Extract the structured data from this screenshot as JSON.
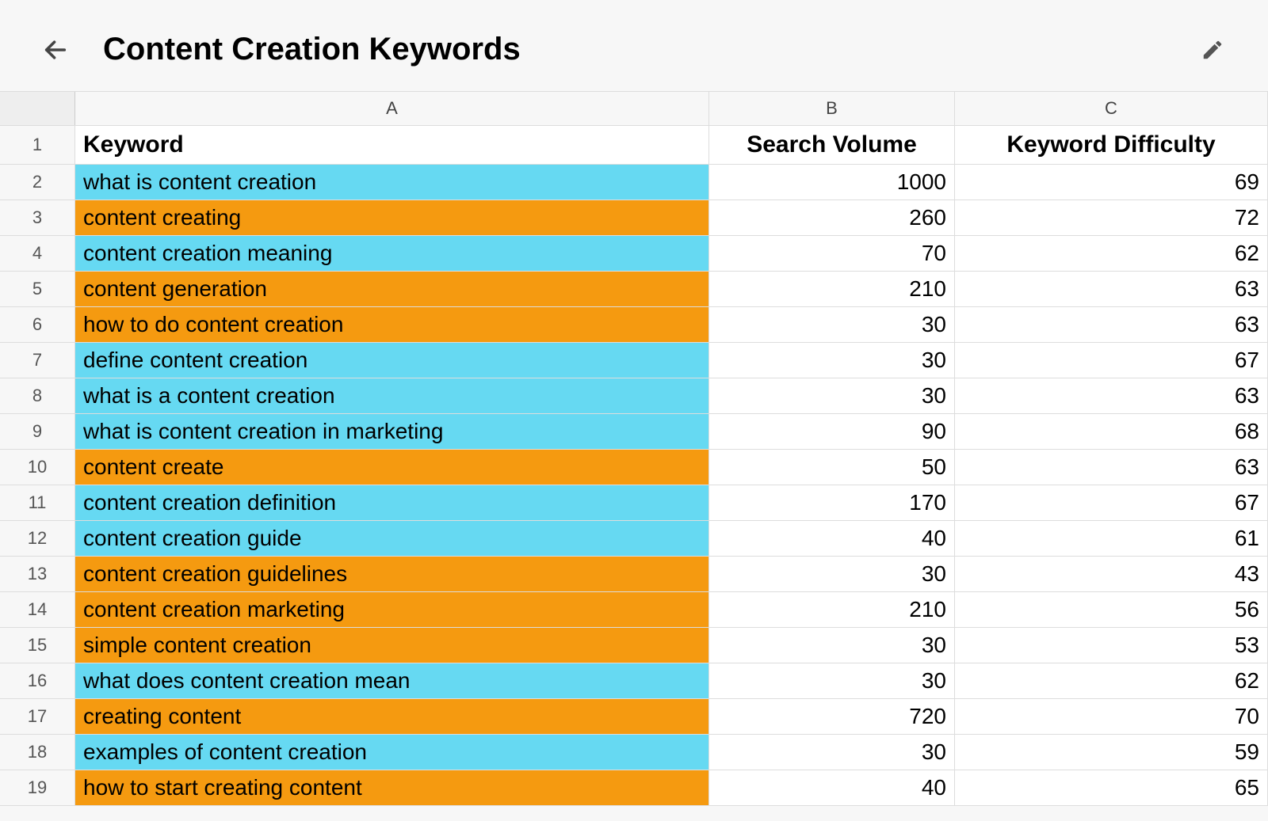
{
  "header": {
    "title": "Content Creation Keywords"
  },
  "columns": [
    "A",
    "B",
    "C"
  ],
  "tableHeaders": {
    "keyword": "Keyword",
    "searchVolume": "Search Volume",
    "keywordDifficulty": "Keyword Difficulty"
  },
  "colors": {
    "blue": "#66d9f2",
    "orange": "#f59a10"
  },
  "rows": [
    {
      "num": 2,
      "keyword": "what is content creation",
      "volume": "1000",
      "difficulty": "69",
      "highlight": "blue"
    },
    {
      "num": 3,
      "keyword": "content creating",
      "volume": "260",
      "difficulty": "72",
      "highlight": "orange"
    },
    {
      "num": 4,
      "keyword": "content creation meaning",
      "volume": "70",
      "difficulty": "62",
      "highlight": "blue"
    },
    {
      "num": 5,
      "keyword": "content generation",
      "volume": "210",
      "difficulty": "63",
      "highlight": "orange"
    },
    {
      "num": 6,
      "keyword": "how to do content creation",
      "volume": "30",
      "difficulty": "63",
      "highlight": "orange"
    },
    {
      "num": 7,
      "keyword": "define content creation",
      "volume": "30",
      "difficulty": "67",
      "highlight": "blue"
    },
    {
      "num": 8,
      "keyword": "what is a content creation",
      "volume": "30",
      "difficulty": "63",
      "highlight": "blue"
    },
    {
      "num": 9,
      "keyword": "what is content creation in marketing",
      "volume": "90",
      "difficulty": "68",
      "highlight": "blue"
    },
    {
      "num": 10,
      "keyword": "content create",
      "volume": "50",
      "difficulty": "63",
      "highlight": "orange"
    },
    {
      "num": 11,
      "keyword": "content creation definition",
      "volume": "170",
      "difficulty": "67",
      "highlight": "blue"
    },
    {
      "num": 12,
      "keyword": "content creation guide",
      "volume": "40",
      "difficulty": "61",
      "highlight": "blue"
    },
    {
      "num": 13,
      "keyword": "content creation guidelines",
      "volume": "30",
      "difficulty": "43",
      "highlight": "orange"
    },
    {
      "num": 14,
      "keyword": "content creation marketing",
      "volume": "210",
      "difficulty": "56",
      "highlight": "orange"
    },
    {
      "num": 15,
      "keyword": "simple content creation",
      "volume": "30",
      "difficulty": "53",
      "highlight": "orange"
    },
    {
      "num": 16,
      "keyword": "what does content creation mean",
      "volume": "30",
      "difficulty": "62",
      "highlight": "blue"
    },
    {
      "num": 17,
      "keyword": "creating content",
      "volume": "720",
      "difficulty": "70",
      "highlight": "orange"
    },
    {
      "num": 18,
      "keyword": "examples of content creation",
      "volume": "30",
      "difficulty": "59",
      "highlight": "blue"
    },
    {
      "num": 19,
      "keyword": "how to start creating content",
      "volume": "40",
      "difficulty": "65",
      "highlight": "orange"
    }
  ]
}
